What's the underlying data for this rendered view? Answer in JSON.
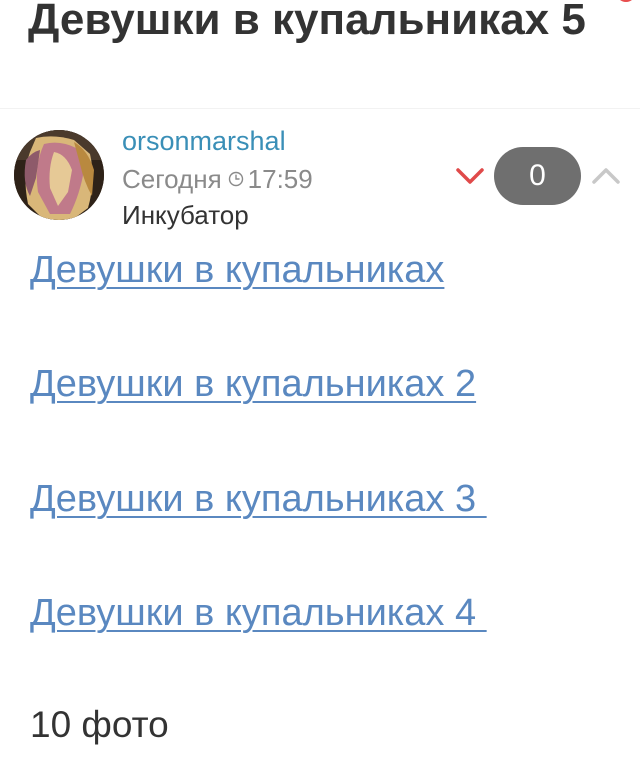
{
  "post": {
    "title": "Девушки в купальниках 5",
    "author": "orsonmarshal",
    "date": "Сегодня",
    "time": "17:59",
    "community": "Инкубатор",
    "rating": "0",
    "links": [
      "Девушки в купальниках",
      "Девушки в купальниках 2",
      "Девушки в купальниках 3 ",
      "Девушки в купальниках 4 "
    ],
    "photo_count": "10 фото"
  },
  "icons": {
    "clock": "clock-icon",
    "vote_down": "chevron-down-icon",
    "vote_up": "chevron-up-icon",
    "notification": "notification-dot-icon"
  },
  "colors": {
    "author": "#3a8fb7",
    "link": "#5a88c0",
    "vote_down": "#e04a4a",
    "vote_up": "#c8c8c8",
    "rating_badge": "#6f6f6f",
    "notification": "#e84e4e"
  }
}
